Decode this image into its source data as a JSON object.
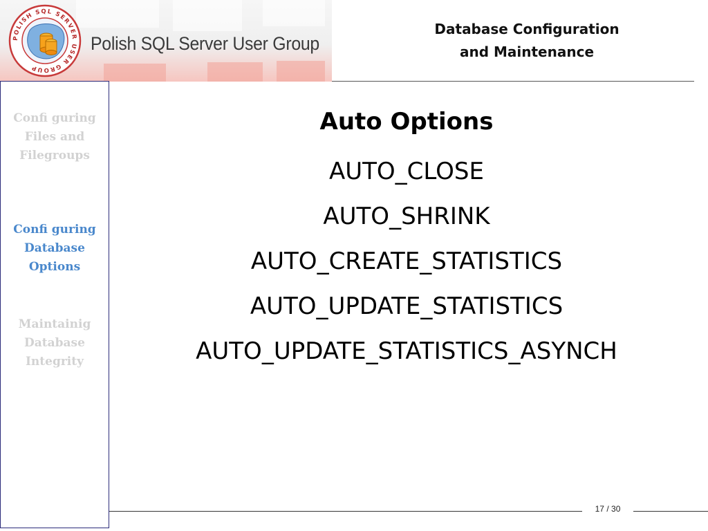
{
  "header": {
    "brand_name": "Polish SQL Server User Group",
    "logo_ring_text": "POLISH SQL SERVER USER GROUP",
    "slide_title_line1": "Database Configuration",
    "slide_title_line2": "and Maintenance"
  },
  "sidebar": {
    "items": [
      {
        "label": "Confi guring Files and Filegroups",
        "state": "inactive"
      },
      {
        "label": "Confi guring Database Options",
        "state": "active"
      },
      {
        "label": "Maintainig Database Integrity",
        "state": "inactive"
      }
    ],
    "active_color": "#4a88cc",
    "inactive_color": "#d2d2d2"
  },
  "main": {
    "heading": "Auto Options",
    "options": [
      "AUTO_CLOSE",
      "AUTO_SHRINK",
      "AUTO_CREATE_STATISTICS",
      "AUTO_UPDATE_STATISTICS",
      "AUTO_UPDATE_STATISTICS_ASYNCH"
    ]
  },
  "footer": {
    "page": "17",
    "separator": "/",
    "total": "30"
  }
}
